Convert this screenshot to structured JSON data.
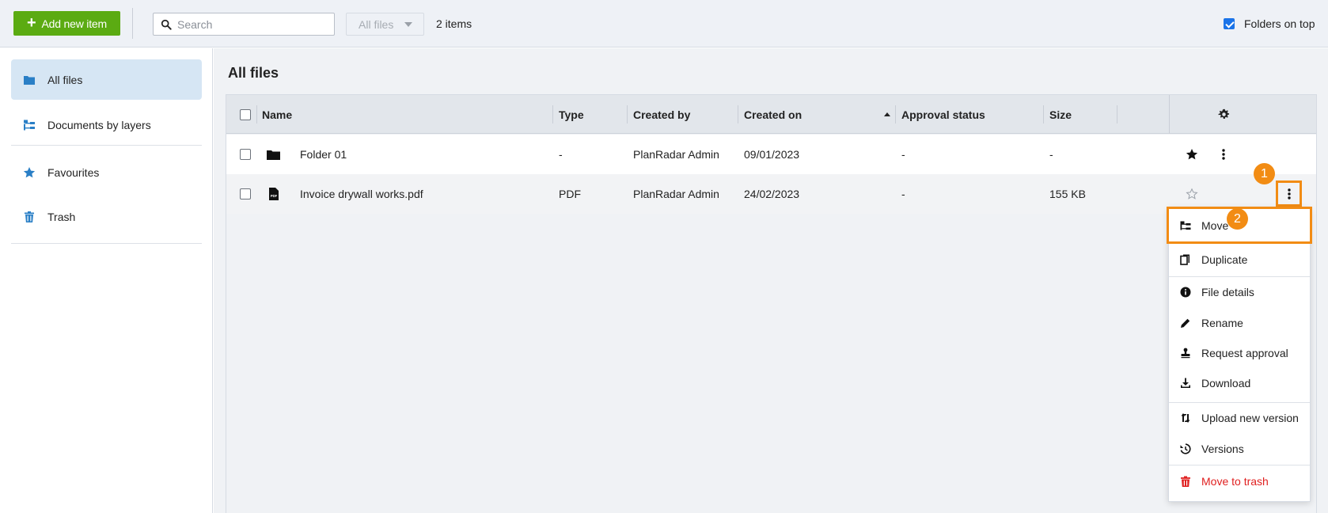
{
  "toolbar": {
    "add_button_label": "Add new item",
    "search_placeholder": "Search",
    "filter_value": "All files",
    "item_count": "2 items",
    "folders_on_top_label": "Folders on top",
    "folders_on_top_checked": true
  },
  "sidebar": {
    "items": [
      {
        "label": "All files",
        "icon": "folder-icon",
        "active": true
      },
      {
        "label": "Documents by layers",
        "icon": "layers-icon",
        "active": false
      },
      {
        "label": "Favourites",
        "icon": "star-icon",
        "active": false
      },
      {
        "label": "Trash",
        "icon": "trash-icon",
        "active": false
      }
    ]
  },
  "main": {
    "title": "All files",
    "columns": [
      "Name",
      "Type",
      "Created by",
      "Created on",
      "Approval status",
      "Size"
    ],
    "sorted_column": "Created on",
    "sort_direction": "ascending",
    "rows": [
      {
        "name": "Folder 01",
        "icon": "folder-icon",
        "type": "-",
        "created_by": "PlanRadar Admin",
        "created_on": "09/01/2023",
        "approval_status": "-",
        "size": "-",
        "favourite": true
      },
      {
        "name": "Invoice drywall works.pdf",
        "icon": "pdf-icon",
        "type": "PDF",
        "created_by": "PlanRadar Admin",
        "created_on": "24/02/2023",
        "approval_status": "-",
        "size": "155 KB",
        "favourite": false
      }
    ]
  },
  "callouts": [
    "1",
    "2"
  ],
  "context_menu": {
    "items": [
      {
        "label": "Move",
        "icon": "move-icon"
      },
      {
        "label": "Duplicate",
        "icon": "duplicate-icon"
      },
      {
        "label": "File details",
        "icon": "info-icon"
      },
      {
        "label": "Rename",
        "icon": "pencil-icon"
      },
      {
        "label": "Request approval",
        "icon": "stamp-icon"
      },
      {
        "label": "Download",
        "icon": "download-icon"
      },
      {
        "label": "Upload new version",
        "icon": "upload-version-icon"
      },
      {
        "label": "Versions",
        "icon": "history-icon"
      },
      {
        "label": "Move to trash",
        "icon": "trash-icon",
        "danger": true
      }
    ]
  },
  "colors": {
    "brand_green": "#5bab12",
    "highlight_orange": "#f28c14",
    "active_blue": "#d6e6f4",
    "danger_red": "#e02020",
    "icon_blue": "#2a7fc6"
  }
}
